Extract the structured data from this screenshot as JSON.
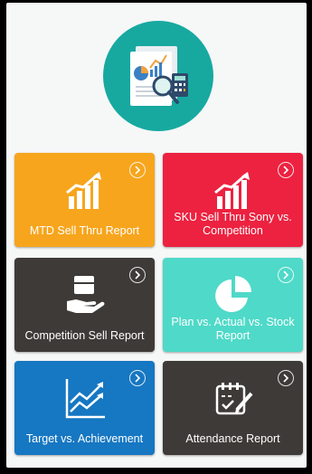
{
  "header": {
    "logo_icon": "report-analytics-icon",
    "logo_color": "#17a9a0"
  },
  "tiles": [
    {
      "label": "MTD Sell Thru Report",
      "color": "#f7a51d",
      "icon": "bar-chart-growth-icon"
    },
    {
      "label": "SKU Sell Thru Sony vs. Competition",
      "color": "#ec2240",
      "icon": "bar-chart-growth-icon"
    },
    {
      "label": "Competition Sell Report",
      "color": "#3e3a37",
      "icon": "box-in-hand-icon"
    },
    {
      "label": "Plan vs. Actual vs. Stock Report",
      "color": "#4fd9c8",
      "icon": "pie-chart-icon"
    },
    {
      "label": "Target vs. Achievement",
      "color": "#1677c2",
      "icon": "trend-lines-icon"
    },
    {
      "label": "Attendance Report",
      "color": "#3e3a37",
      "icon": "calendar-check-icon"
    }
  ]
}
